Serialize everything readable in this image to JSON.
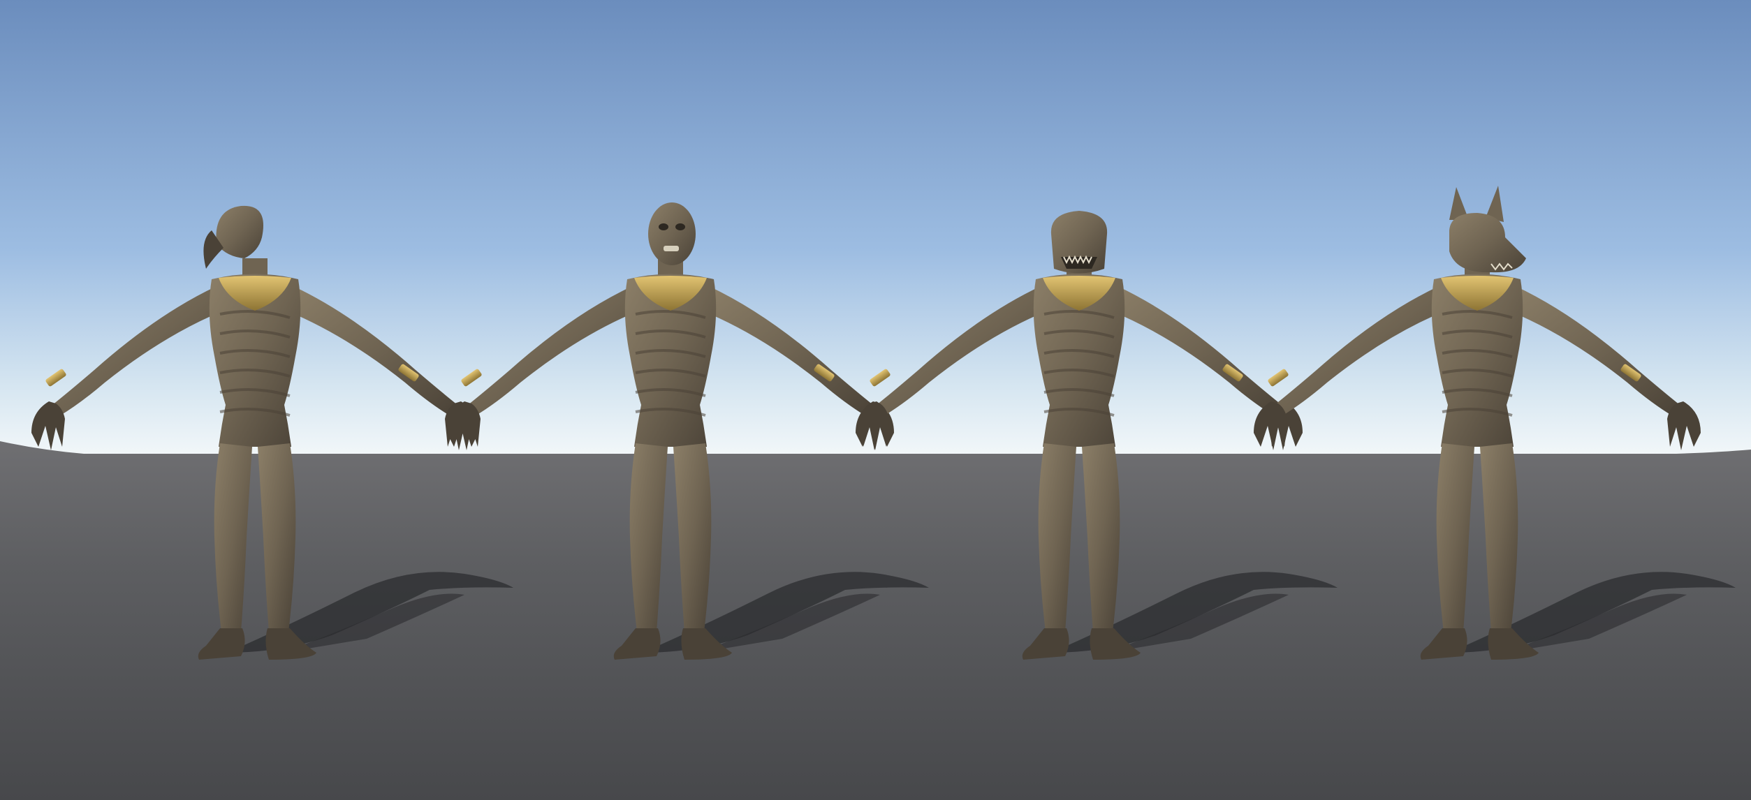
{
  "scene": {
    "colors": {
      "sky_top": "#6b8dbd",
      "sky_mid": "#8fb0dc",
      "sky_horizon": "#eef4f8",
      "ground_near": "#4b4c4f",
      "ground_far": "#6f6f72",
      "shadow": "#2b2c2f",
      "skin_dark": "#4a4237",
      "skin_mid": "#6f6452",
      "skin_light": "#8c7f68",
      "gold": "#c9a85a",
      "gold_dark": "#8d7434"
    },
    "characters": [
      {
        "name": "falcon-headed-mummy",
        "head": "falcon"
      },
      {
        "name": "human-headed-mummy",
        "head": "human"
      },
      {
        "name": "crocodile-headed-mummy",
        "head": "crocodile"
      },
      {
        "name": "jackal-headed-mummy",
        "head": "jackal"
      }
    ]
  }
}
